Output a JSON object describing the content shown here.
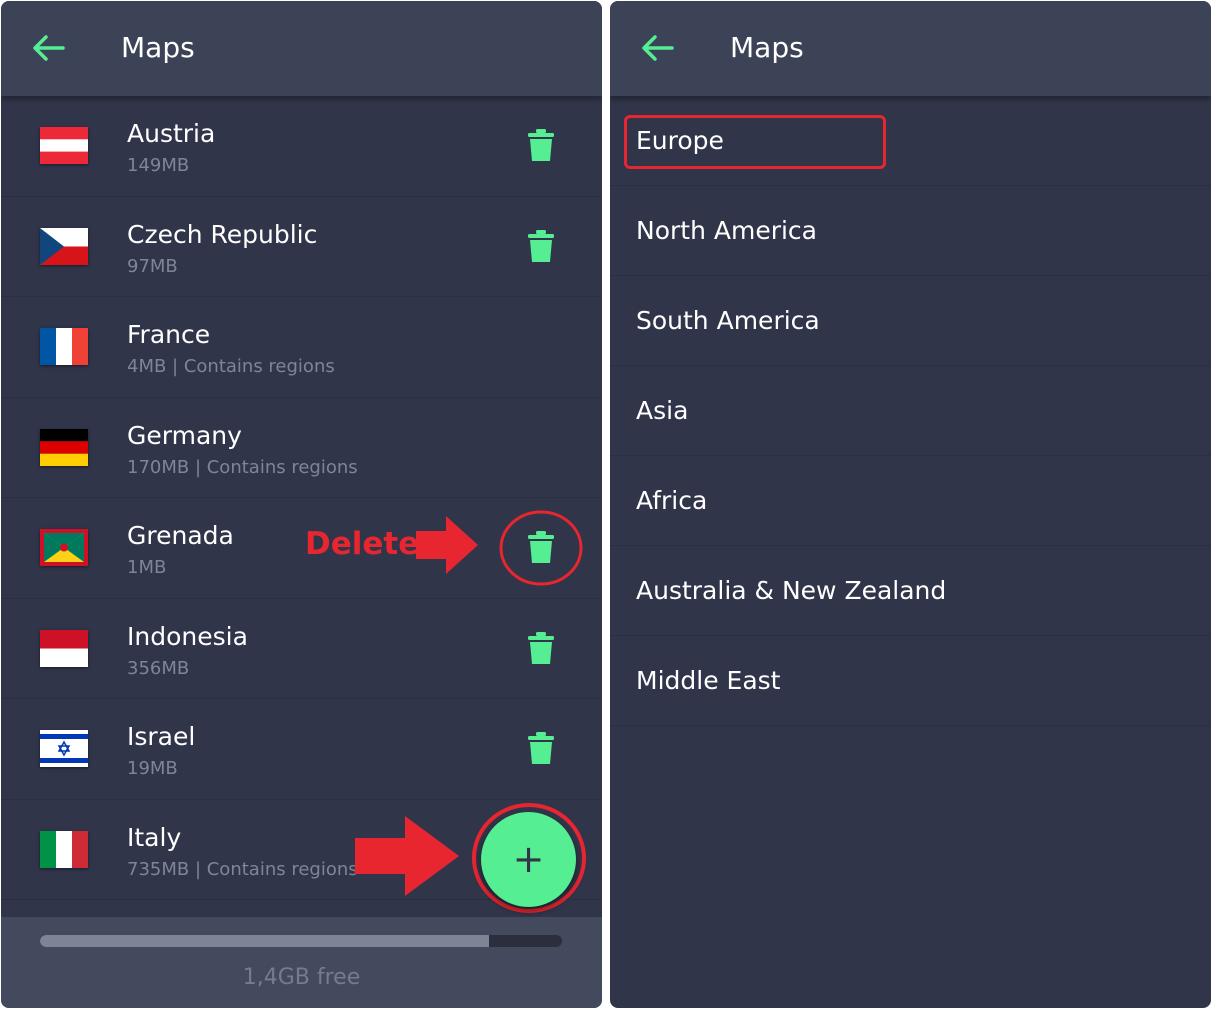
{
  "colors": {
    "background": "#30354a",
    "header": "#3d4357",
    "accent": "#55ee92",
    "annotation": "#e8262f",
    "subtext": "#7f8596"
  },
  "left_panel": {
    "title": "Maps",
    "back_icon": "arrow-left-icon",
    "maps": [
      {
        "name": "Austria",
        "info": "149MB",
        "flag": "austria-flag-icon",
        "deletable": true
      },
      {
        "name": "Czech Republic",
        "info": "97MB",
        "flag": "czech-flag-icon",
        "deletable": true
      },
      {
        "name": "France",
        "info": "4MB | Contains regions",
        "flag": "france-flag-icon",
        "deletable": false
      },
      {
        "name": "Germany",
        "info": "170MB | Contains regions",
        "flag": "germany-flag-icon",
        "deletable": false
      },
      {
        "name": "Grenada",
        "info": "1MB",
        "flag": "grenada-flag-icon",
        "deletable": true
      },
      {
        "name": "Indonesia",
        "info": "356MB",
        "flag": "indonesia-flag-icon",
        "deletable": true
      },
      {
        "name": "Israel",
        "info": "19MB",
        "flag": "israel-flag-icon",
        "deletable": true
      },
      {
        "name": "Italy",
        "info": "735MB | Contains regions",
        "flag": "italy-flag-icon",
        "deletable": false
      }
    ],
    "storage": {
      "used_fraction": 0.86,
      "free_label": "1,4GB free"
    },
    "fab_icon": "plus-icon",
    "fab_symbol": "+",
    "annotation_label": "Delete"
  },
  "right_panel": {
    "title": "Maps",
    "back_icon": "arrow-left-icon",
    "regions": [
      {
        "label": "Europe",
        "highlighted": true
      },
      {
        "label": "North America"
      },
      {
        "label": "South America"
      },
      {
        "label": "Asia"
      },
      {
        "label": "Africa"
      },
      {
        "label": "Australia & New Zealand"
      },
      {
        "label": "Middle East"
      }
    ]
  }
}
